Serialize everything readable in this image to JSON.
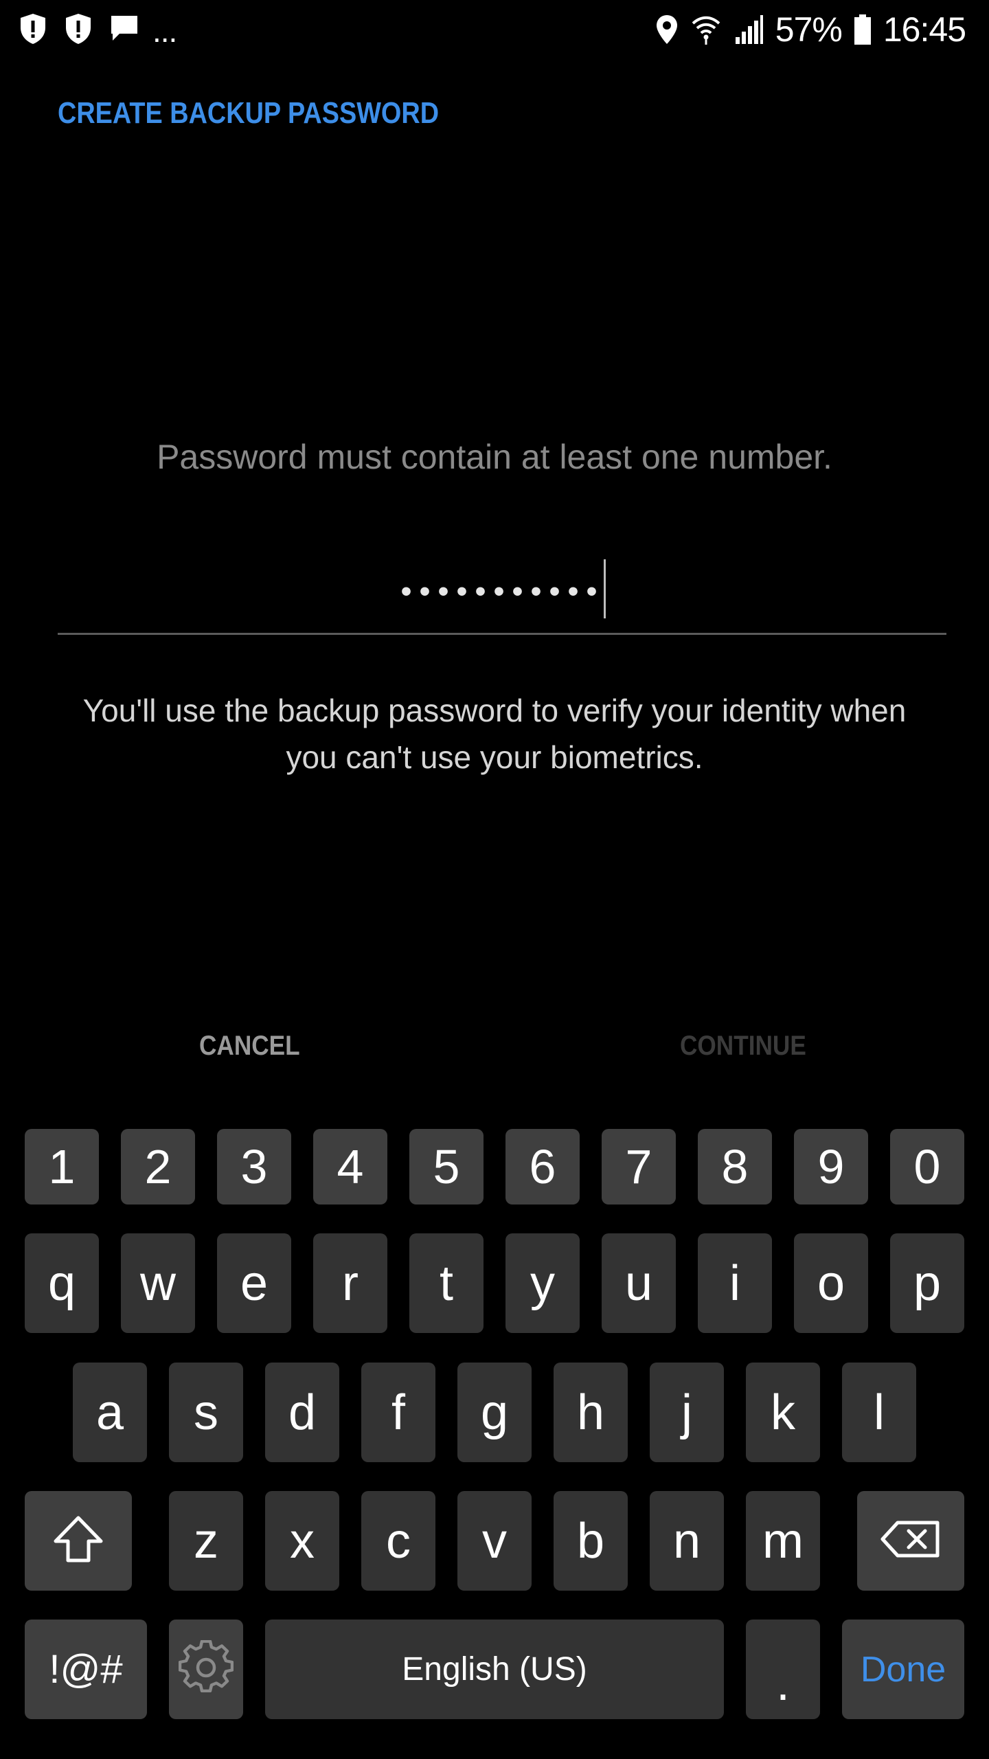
{
  "status_bar": {
    "left_icons": [
      "shield-alert-icon",
      "shield-alert-icon",
      "chat-message-icon"
    ],
    "overflow": "...",
    "right_icons": [
      "location-pin-icon",
      "wifi-icon",
      "cell-signal-icon"
    ],
    "battery": "57%",
    "time": "16:45"
  },
  "dialog": {
    "title": "CREATE BACKUP PASSWORD",
    "hint": "Password must contain at least one number.",
    "password_value": "•••••••••••",
    "description_line1": "You'll use the backup password to verify your identity when",
    "description_line2": "you can't use your biometrics.",
    "cancel_label": "CANCEL",
    "continue_label": "CONTINUE"
  },
  "keyboard": {
    "number_row": [
      "1",
      "2",
      "3",
      "4",
      "5",
      "6",
      "7",
      "8",
      "9",
      "0"
    ],
    "row1": [
      "q",
      "w",
      "e",
      "r",
      "t",
      "y",
      "u",
      "i",
      "o",
      "p"
    ],
    "row2": [
      "a",
      "s",
      "d",
      "f",
      "g",
      "h",
      "j",
      "k",
      "l"
    ],
    "row3": [
      "z",
      "x",
      "c",
      "v",
      "b",
      "n",
      "m"
    ],
    "symbols_label": "!@#",
    "space_label": "English (US)",
    "period_label": ".",
    "done_label": "Done",
    "accent_color": "#3f8fe9"
  },
  "colors": {
    "title": "#3d8ee8",
    "background": "#000000"
  }
}
